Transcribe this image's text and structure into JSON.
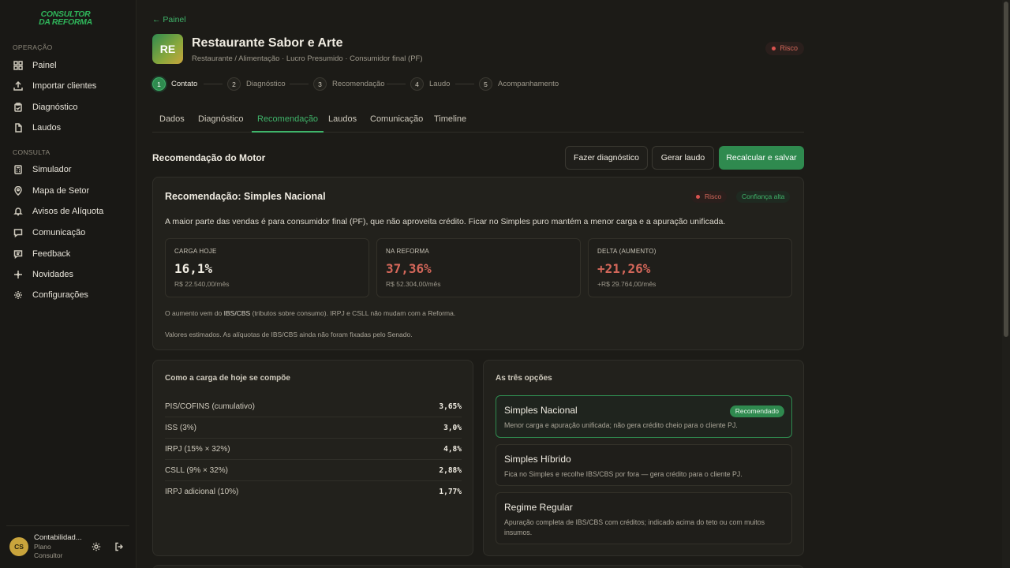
{
  "brand": {
    "line1": "CONSULTOR",
    "line2": "DA REFORMA",
    "color": "#2fb55a"
  },
  "sidebar": {
    "section_operacao": "OPERAÇÃO",
    "section_consulta": "CONSULTA",
    "items": [
      {
        "label": "Painel",
        "icon": "dashboard-icon"
      },
      {
        "label": "Importar clientes",
        "icon": "upload-icon"
      },
      {
        "label": "Diagnóstico",
        "icon": "clipboard-icon"
      },
      {
        "label": "Laudos",
        "icon": "document-icon"
      },
      {
        "label": "Simulador",
        "icon": "calculator-icon"
      },
      {
        "label": "Mapa de Setor",
        "icon": "map-pin-icon"
      },
      {
        "label": "Avisos de Alíquota",
        "icon": "bell-icon"
      },
      {
        "label": "Comunicação",
        "icon": "chat-icon"
      },
      {
        "label": "Feedback",
        "icon": "feedback-icon"
      },
      {
        "label": "Novidades",
        "icon": "sparkle-icon"
      },
      {
        "label": "Configurações",
        "icon": "gear-icon"
      }
    ],
    "user": {
      "initials": "CS",
      "name": "Contabilidad...",
      "plan": "Plano Consultor"
    }
  },
  "header": {
    "back": "← Painel",
    "client_initials": "RE",
    "client_name": "Restaurante Sabor e Arte",
    "client_meta": "Restaurante / Alimentação · Lucro Presumido · Consumidor final (PF)",
    "risk": "Risco"
  },
  "stepper": [
    {
      "num": "1",
      "label": "Contato",
      "active": true
    },
    {
      "num": "2",
      "label": "Diagnóstico"
    },
    {
      "num": "3",
      "label": "Recomendação"
    },
    {
      "num": "4",
      "label": "Laudo"
    },
    {
      "num": "5",
      "label": "Acompanhamento"
    }
  ],
  "tabs": [
    "Dados",
    "Diagnóstico",
    "Recomendação",
    "Laudos",
    "Comunicação",
    "Timeline"
  ],
  "active_tab": "Recomendação",
  "section": {
    "title": "Recomendação do Motor",
    "btn_diagnostico": "Fazer diagnóstico",
    "btn_laudo": "Gerar laudo",
    "btn_recalcular": "Recalcular e salvar"
  },
  "recommendation": {
    "title": "Recomendação: Simples Nacional",
    "risk_badge": "Risco",
    "confidence_badge": "Confiança alta",
    "description": "A maior parte das vendas é para consumidor final (PF), que não aproveita crédito. Ficar no Simples puro mantém a menor carga e a apuração unificada.",
    "metrics": [
      {
        "label": "CARGA HOJE",
        "value": "16,1%",
        "sub": "R$ 22.540,00/mês"
      },
      {
        "label": "NA REFORMA",
        "value": "37,36%",
        "sub": "R$ 52.304,00/mês"
      },
      {
        "label": "DELTA (AUMENTO)",
        "value": "+21,26%",
        "sub": "+R$ 29.764,00/mês"
      }
    ],
    "note1_prefix": "O aumento vem do ",
    "note1_bold": "IBS/CBS",
    "note1_suffix": " (tributos sobre consumo). IRPJ e CSLL não mudam com a Reforma.",
    "note2": "Valores estimados. As alíquotas de IBS/CBS ainda não foram fixadas pelo Senado."
  },
  "composition": {
    "title": "Como a carga de hoje se compõe",
    "rows": [
      {
        "label": "PIS/COFINS (cumulativo)",
        "value": "3,65%"
      },
      {
        "label": "ISS (3%)",
        "value": "3,0%"
      },
      {
        "label": "IRPJ (15% × 32%)",
        "value": "4,8%"
      },
      {
        "label": "CSLL (9% × 32%)",
        "value": "2,88%"
      },
      {
        "label": "IRPJ adicional (10%)",
        "value": "1,77%"
      }
    ]
  },
  "options": {
    "title": "As três opções",
    "recommended_badge": "Recomendado",
    "items": [
      {
        "title": "Simples Nacional",
        "desc": "Menor carga e apuração unificada; não gera crédito cheio para o cliente PJ."
      },
      {
        "title": "Simples Híbrido",
        "desc": "Fica no Simples e recolhe IBS/CBS por fora — gera crédito para o cliente PJ."
      },
      {
        "title": "Regime Regular",
        "desc": "Apuração completa de IBS/CBS com créditos; indicado acima do teto ou com muitos insumos."
      }
    ]
  },
  "colors": {
    "accent": "#2f8a4f",
    "risk": "#d4675a",
    "background": "#1c1b17"
  }
}
